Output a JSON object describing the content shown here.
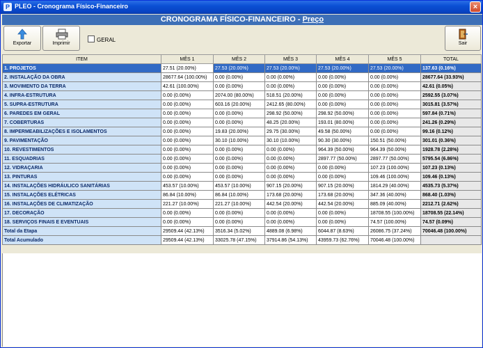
{
  "window": {
    "title": "PLEO - Cronograma Físico-Financeiro",
    "icon": "pleo-app-icon",
    "close_label": "×"
  },
  "header": {
    "title": "CRONOGRAMA FÍSICO-FINANCEIRO - ",
    "subtitle": "Preço"
  },
  "toolbar": {
    "export_label": "Exportar",
    "export_icon": "export-arrow-icon",
    "print_label": "Imprimir",
    "print_icon": "printer-icon",
    "geral_label": "GERAL",
    "geral_checked": false,
    "exit_label": "Sair",
    "exit_icon": "exit-door-icon"
  },
  "columns": [
    "ITEM",
    "MÊS 1",
    "MÊS 2",
    "MÊS 3",
    "MÊS 4",
    "MÊS 5",
    "TOTAL"
  ],
  "rows": [
    {
      "item": "1.  PROJETOS",
      "values": [
        "27.51 (20.00%)",
        "27.53 (20.00%)",
        "27.53 (20.00%)",
        "27.53 (20.00%)",
        "27.53 (20.00%)"
      ],
      "total": "137.63 (0.16%)",
      "selected": true
    },
    {
      "item": "2.  INSTALAÇÃO DA OBRA",
      "values": [
        "28677.64 (100.00%)",
        "0.00 (0.00%)",
        "0.00 (0.00%)",
        "0.00 (0.00%)",
        "0.00 (0.00%)"
      ],
      "total": "28677.64 (33.93%)"
    },
    {
      "item": "3.  MOVIMENTO DA TERRA",
      "values": [
        "42.61 (100.00%)",
        "0.00 (0.00%)",
        "0.00 (0.00%)",
        "0.00 (0.00%)",
        "0.00 (0.00%)"
      ],
      "total": "42.61 (0.05%)"
    },
    {
      "item": "4.  INFRA-ESTRUTURA",
      "values": [
        "0.00 (0.00%)",
        "2074.00 (80.00%)",
        "518.51 (20.00%)",
        "0.00 (0.00%)",
        "0.00 (0.00%)"
      ],
      "total": "2592.55 (3.07%)"
    },
    {
      "item": "5.  SUPRA-ESTRUTURA",
      "values": [
        "0.00 (0.00%)",
        "603.16 (20.00%)",
        "2412.65 (80.00%)",
        "0.00 (0.00%)",
        "0.00 (0.00%)"
      ],
      "total": "3015.81 (3.57%)"
    },
    {
      "item": "6.  PAREDES EM GERAL",
      "values": [
        "0.00 (0.00%)",
        "0.00 (0.00%)",
        "298.92 (50.00%)",
        "298.92 (50.00%)",
        "0.00 (0.00%)"
      ],
      "total": "597.84 (0.71%)"
    },
    {
      "item": "7.  COBERTURAS",
      "values": [
        "0.00 (0.00%)",
        "0.00 (0.00%)",
        "48.25 (20.00%)",
        "193.01 (80.00%)",
        "0.00 (0.00%)"
      ],
      "total": "241.26 (0.29%)"
    },
    {
      "item": "8.  IMPERMEABILIZAÇÕES E ISOLAMENTOS",
      "values": [
        "0.00 (0.00%)",
        "19.83 (20.00%)",
        "29.75 (30.00%)",
        "49.58 (50.00%)",
        "0.00 (0.00%)"
      ],
      "total": "99.16 (0.12%)"
    },
    {
      "item": "9.  PAVIMENTAÇÃO",
      "values": [
        "0.00 (0.00%)",
        "30.10 (10.00%)",
        "30.10 (10.00%)",
        "90.30 (30.00%)",
        "150.51 (50.00%)"
      ],
      "total": "301.01 (0.36%)"
    },
    {
      "item": "10.   REVESTIMENTOS",
      "values": [
        "0.00 (0.00%)",
        "0.00 (0.00%)",
        "0.00 (0.00%)",
        "964.39 (50.00%)",
        "964.39 (50.00%)"
      ],
      "total": "1928.78 (2.28%)"
    },
    {
      "item": "11.   ESQUADRIAS",
      "values": [
        "0.00 (0.00%)",
        "0.00 (0.00%)",
        "0.00 (0.00%)",
        "2897.77 (50.00%)",
        "2897.77 (50.00%)"
      ],
      "total": "5795.54 (6.86%)"
    },
    {
      "item": "12.  VIDRAÇARIA",
      "values": [
        "0.00 (0.00%)",
        "0.00 (0.00%)",
        "0.00 (0.00%)",
        "0.00 (0.00%)",
        "107.23 (100.00%)"
      ],
      "total": "107.23 (0.13%)"
    },
    {
      "item": "13.  PINTURAS",
      "values": [
        "0.00 (0.00%)",
        "0.00 (0.00%)",
        "0.00 (0.00%)",
        "0.00 (0.00%)",
        "109.46 (100.00%)"
      ],
      "total": "109.46 (0.13%)"
    },
    {
      "item": "14.  INSTALAÇÕES HIDRÁULICO SANITÁRIAS",
      "values": [
        "453.57 (10.00%)",
        "453.57 (10.00%)",
        "907.15 (20.00%)",
        "907.15 (20.00%)",
        "1814.29 (40.00%)"
      ],
      "total": "4535.73 (5.37%)"
    },
    {
      "item": "15.  INSTALAÇÕES ELÉTRICAS",
      "values": [
        "86.84 (10.00%)",
        "86.84 (10.00%)",
        "173.68 (20.00%)",
        "173.68 (20.00%)",
        "347.36 (40.00%)"
      ],
      "total": "868.40 (1.03%)"
    },
    {
      "item": "16.  INSTALAÇÕES DE CLIMATIZAÇÃO",
      "values": [
        "221.27 (10.00%)",
        "221.27 (10.00%)",
        "442.54 (20.00%)",
        "442.54 (20.00%)",
        "885.09 (40.00%)"
      ],
      "total": "2212.71 (2.62%)"
    },
    {
      "item": "17.  DECORAÇÃO",
      "values": [
        "0.00 (0.00%)",
        "0.00 (0.00%)",
        "0.00 (0.00%)",
        "0.00 (0.00%)",
        "18708.55 (100.00%)"
      ],
      "total": "18708.55 (22.14%)"
    },
    {
      "item": "18.  SERVIÇOS FINAIS E EVENTUAIS",
      "values": [
        "0.00 (0.00%)",
        "0.00 (0.00%)",
        "0.00 (0.00%)",
        "0.00 (0.00%)",
        "74.57 (100.00%)"
      ],
      "total": "74.57 (0.09%)"
    }
  ],
  "footer": [
    {
      "item": "Total  da Etapa",
      "values": [
        "29509.44 (42.13%)",
        "3516.34 (5.02%)",
        "4889.08 (6.98%)",
        "6044.87 (8.63%)",
        "26086.75 (37.24%)"
      ],
      "total": "70046.48 (100.00%)"
    },
    {
      "item": "Total Acumulado",
      "values": [
        "29509.44 (42.13%)",
        "33025.78 (47.15%)",
        "37914.86 (54.13%)",
        "43959.73 (62.76%)",
        "70046.48 (100.00%)"
      ],
      "total": ""
    }
  ],
  "colors": {
    "title_bar": "#0a4fd4",
    "header": "#3d6fb7",
    "item_cell": "#cfe3f7",
    "selection": "#316ac5"
  }
}
